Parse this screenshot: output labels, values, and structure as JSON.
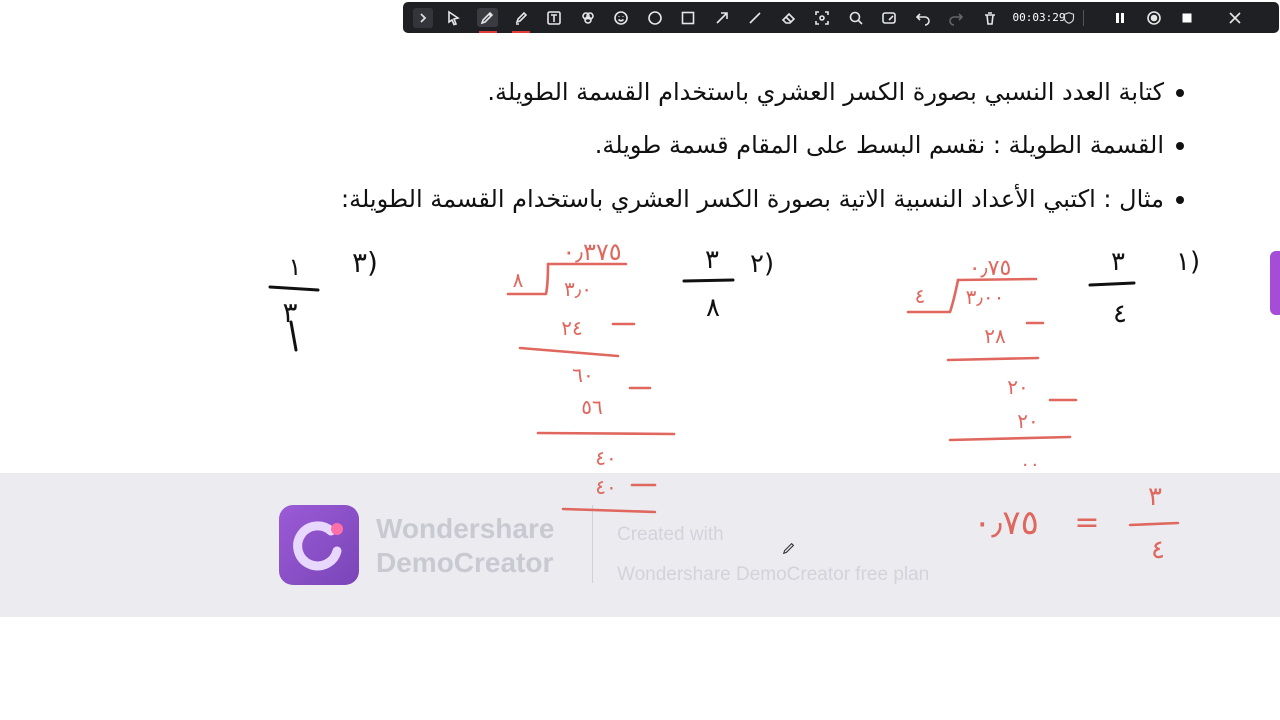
{
  "toolbar": {
    "timer": "00:03:29",
    "tools": [
      {
        "name": "collapse-button",
        "icon": "chevron-right-icon"
      },
      {
        "name": "select-tool",
        "icon": "cursor-icon"
      },
      {
        "name": "pen-tool",
        "icon": "pen-icon"
      },
      {
        "name": "highlighter-tool",
        "icon": "highlighter-icon"
      },
      {
        "name": "text-tool",
        "icon": "text-icon"
      },
      {
        "name": "palette-tool",
        "icon": "palette-icon"
      },
      {
        "name": "emoji-tool",
        "icon": "emoji-icon"
      },
      {
        "name": "circle-tool",
        "icon": "circle-icon"
      },
      {
        "name": "rectangle-tool",
        "icon": "rectangle-icon"
      },
      {
        "name": "arrow-tool",
        "icon": "arrow-icon"
      },
      {
        "name": "line-tool",
        "icon": "line-icon"
      },
      {
        "name": "eraser-tool",
        "icon": "eraser-icon"
      },
      {
        "name": "spotlight-tool",
        "icon": "spotlight-icon"
      },
      {
        "name": "zoom-tool",
        "icon": "magnifier-icon"
      },
      {
        "name": "whiteboard-tool",
        "icon": "whiteboard-icon"
      },
      {
        "name": "undo-button",
        "icon": "undo-icon"
      },
      {
        "name": "redo-button",
        "icon": "redo-icon"
      },
      {
        "name": "clear-button",
        "icon": "trash-icon"
      },
      {
        "name": "pause-button",
        "icon": "pause-icon"
      },
      {
        "name": "camera-button",
        "icon": "record-icon"
      },
      {
        "name": "stop-button",
        "icon": "stop-icon"
      },
      {
        "name": "close-button",
        "icon": "close-icon"
      }
    ],
    "accent": "#e23b3b"
  },
  "slide": {
    "bullets": [
      "كتابة العدد النسبي بصورة الكسر العشري باستخدام القسمة الطويلة.",
      "القسمة الطويلة : نقسم البسط على المقام قسمة طويلة.",
      "مثال : اكتبي الأعداد النسبية الاتية بصورة الكسر العشري باستخدام القسمة الطويلة:"
    ]
  },
  "handwriting": {
    "problem1": {
      "label": "١)",
      "numerator": "٣",
      "denominator": "٤",
      "quotient": "٠٫٧٥",
      "steps": [
        "٣٫٠٠",
        "٢٨",
        "٢٠",
        "٢٠",
        "٠٠"
      ],
      "result": "٠٫٧٥",
      "equals": "="
    },
    "problem2": {
      "label": "٢)",
      "numerator": "٣",
      "denominator": "٨",
      "quotient": "٠٫٣٧٥",
      "steps": [
        "٣٫٠",
        "٢٤",
        "٦٠",
        "٥٦",
        "٤٠",
        "٤٠"
      ]
    },
    "problem3": {
      "label": "٣)",
      "numerator": "١",
      "denominator": "٣"
    }
  },
  "watermark": {
    "brand_line1": "Wondershare",
    "brand_line2": "DemoCreator",
    "created_line1": "Created with",
    "created_line2": "Wondershare DemoCreator free plan"
  },
  "colors": {
    "ink_black": "#111111",
    "ink_red": "#e0675e",
    "side_tab": "#a64dd8"
  }
}
